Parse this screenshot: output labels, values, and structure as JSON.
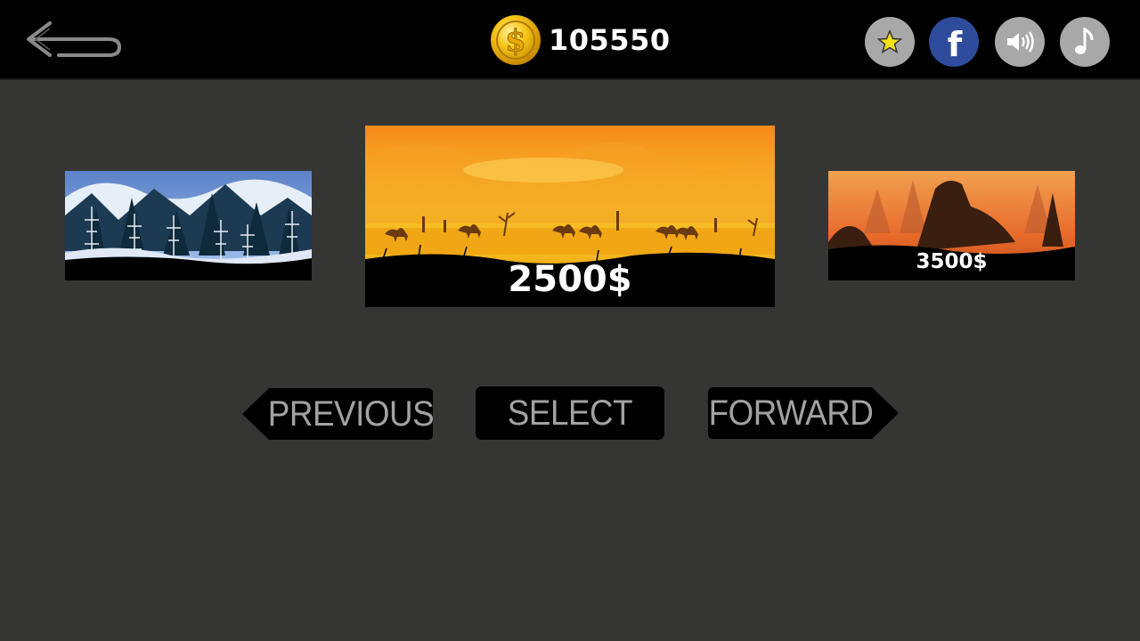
{
  "topbar": {
    "back_icon": "back-arrow-icon",
    "coin_icon": "dollar-coin-icon",
    "coin_count": "105550",
    "buttons": [
      {
        "icon": "star-icon",
        "color": "#a8a8a8"
      },
      {
        "icon": "facebook-icon",
        "color": "#2e4c9b"
      },
      {
        "icon": "speaker-icon",
        "color": "#a8a8a8"
      },
      {
        "icon": "music-note-icon",
        "color": "#a8a8a8"
      }
    ]
  },
  "levels": {
    "previous": {
      "theme": "snowy-forest",
      "price": ""
    },
    "current": {
      "theme": "desert-sunset",
      "price": "2500$"
    },
    "next": {
      "theme": "volcanic-canyon",
      "price": "3500$"
    }
  },
  "nav": {
    "previous_label": "PREVIOUS",
    "select_label": "SELECT",
    "forward_label": "FORWARD"
  },
  "colors": {
    "background": "#353634",
    "topbar": "#000000",
    "button_bg": "#000000",
    "button_text": "#a2a2a2",
    "coin_gold": "#f5b800"
  }
}
